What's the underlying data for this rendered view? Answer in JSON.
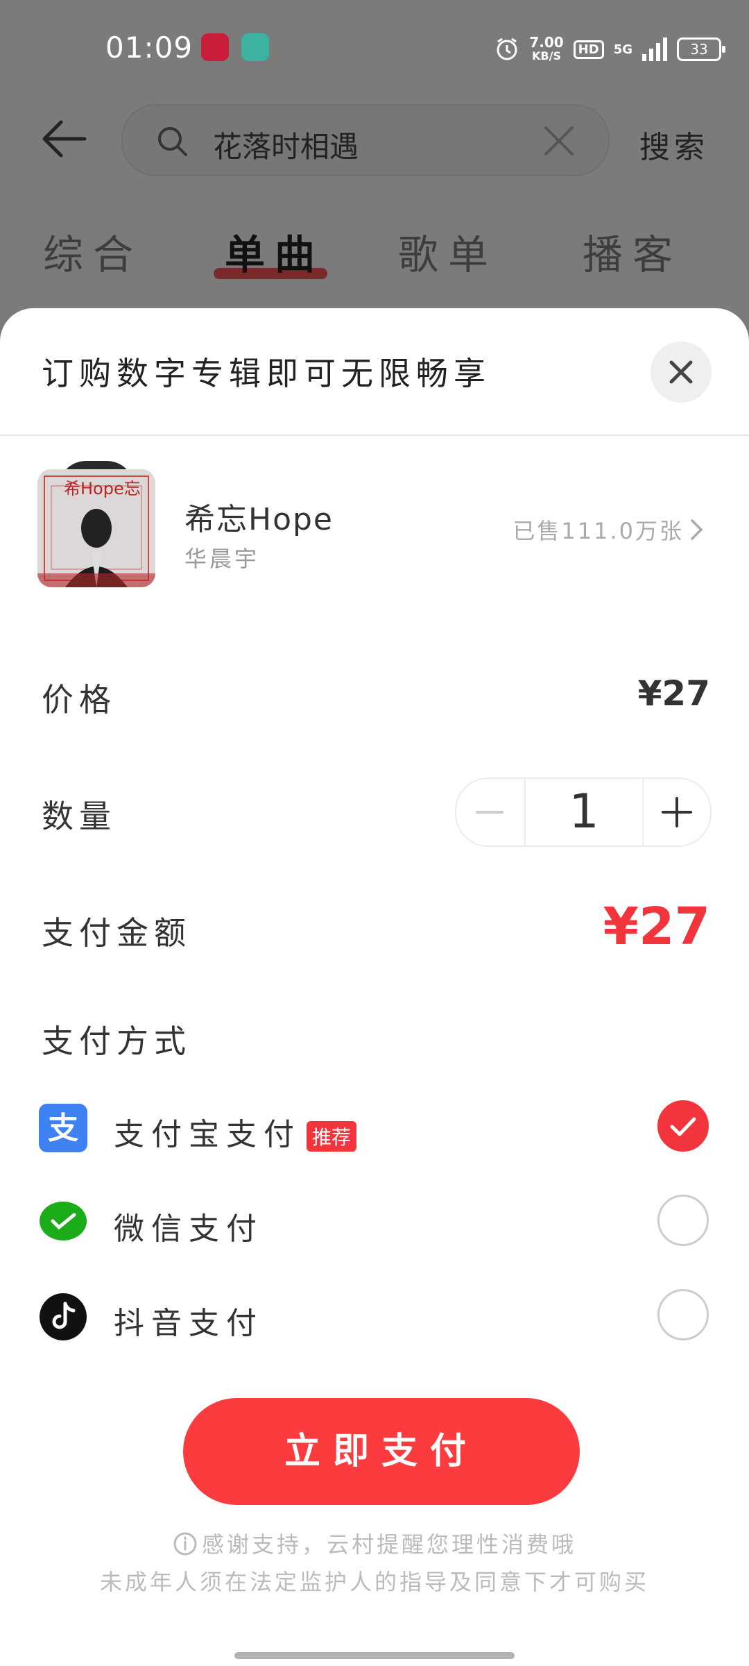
{
  "status_bar": {
    "time": "01:09",
    "speed_value": "7.00",
    "speed_unit": "KB/S",
    "hd": "HD",
    "network": "5G",
    "battery": "33"
  },
  "search": {
    "query": "花落时相遇",
    "button": "搜索"
  },
  "tabs": [
    {
      "label": "综合"
    },
    {
      "label": "单曲"
    },
    {
      "label": "歌单"
    },
    {
      "label": "播客"
    }
  ],
  "sheet": {
    "title": "订购数字专辑即可无限畅享",
    "album": {
      "cover_text": "希Hope忘",
      "name": "希忘Hope",
      "artist": "华晨宇",
      "sold": "已售111.0万张"
    },
    "price_label": "价格",
    "price_value": "¥27",
    "quantity_label": "数量",
    "quantity_value": "1",
    "total_label": "支付金额",
    "total_value": "¥27",
    "method_label": "支付方式",
    "methods": [
      {
        "label": "支付宝支付",
        "badge": "推荐",
        "selected": true,
        "icon": "alipay-icon"
      },
      {
        "label": "微信支付",
        "selected": false,
        "icon": "wechat-pay-icon"
      },
      {
        "label": "抖音支付",
        "selected": false,
        "icon": "douyin-pay-icon"
      }
    ],
    "pay_button": "立即支付",
    "notice_line1": "感谢支持，云村提醒您理性消费哦",
    "notice_line2": "未成年人须在法定监护人的指导及同意下才可购买"
  },
  "colors": {
    "accent": "#fc3b3f",
    "alipay": "#3d82f0",
    "wechat": "#1aad19"
  }
}
